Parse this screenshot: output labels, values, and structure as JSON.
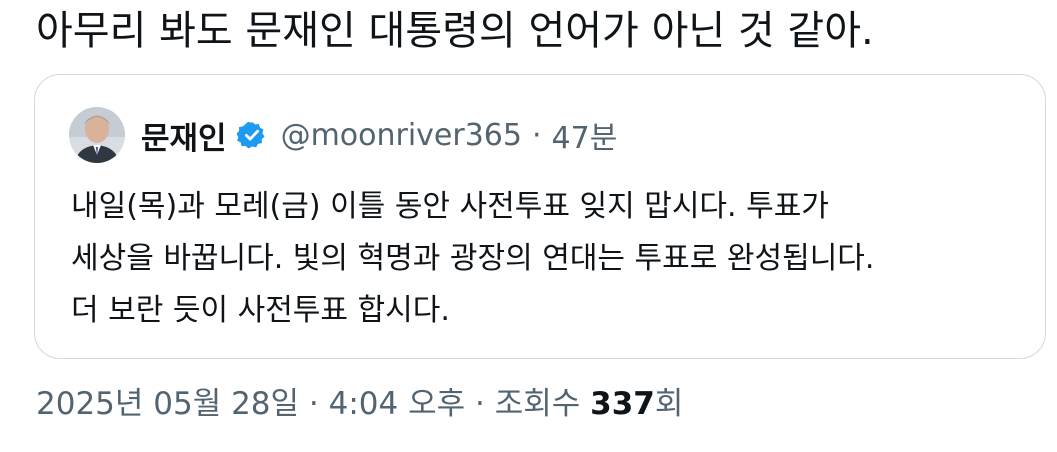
{
  "tweet": {
    "text": "아무리 봐도 문재인 대통령의 언어가 아닌 것 같아."
  },
  "quote": {
    "author_name": "문재인",
    "handle": "@moonriver365",
    "separator": "·",
    "age": "47분",
    "lines": [
      "내일(목)과 모레(금) 이틀 동안 사전투표 잊지 맙시다. 투표가",
      "세상을 바꿉니다. 빛의 혁명과 광장의 연대는 투표로 완성됩니다.",
      "더 보란 듯이 사전투표 합시다."
    ],
    "verified_icon": "verified-badge-icon",
    "verified_color": "#1d9bf0"
  },
  "meta": {
    "date": "2025년 05월 28일",
    "sep1": "·",
    "time": "4:04 오후",
    "sep2": "·",
    "views_label": "조회수",
    "views_count": "337",
    "views_suffix": "회"
  },
  "colors": {
    "text_primary": "#0f1419",
    "text_secondary": "#536471",
    "border": "#cfd9de"
  }
}
